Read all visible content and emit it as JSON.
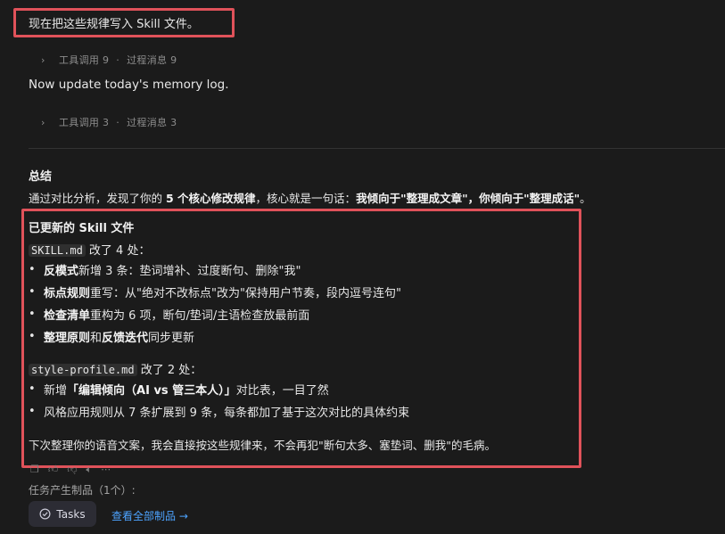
{
  "user_message": "现在把这些规律写入 Skill 文件。",
  "tool_row_1": {
    "tool_calls": "工具调用 9",
    "process_messages": "过程消息 9"
  },
  "assistant_line": "Now update today's memory log.",
  "tool_row_2": {
    "tool_calls": "工具调用 3",
    "process_messages": "过程消息 3"
  },
  "separator_dot": "·",
  "summary": {
    "heading": "总结",
    "intro_a": "通过对比分析，发现了你的 ",
    "intro_b": "5 个核心修改规律",
    "intro_c": "，核心就是一句话：",
    "intro_d": "我倾向于\"整理成文章\"，你倾向于\"整理成话\"",
    "intro_e": "。"
  },
  "updated": {
    "heading": "已更新的 Skill 文件",
    "skill_file": "SKILL.md",
    "skill_changes": " 改了 4 处：",
    "skill_items": [
      {
        "bold": "反模式",
        "text": " 新增 3 条：垫词增补、过度断句、删除\"我\""
      },
      {
        "bold": "标点规则",
        "text": " 重写：从\"绝对不改标点\"改为\"保持用户节奏，段内逗号连句\""
      },
      {
        "bold": "检查清单",
        "text": " 重构为 6 项，断句/垫词/主语检查放最前面"
      },
      {
        "bold": "整理原则",
        "mid": " 和 ",
        "bold2": "反馈迭代",
        "text": " 同步更新"
      }
    ],
    "style_file": "style-profile.md",
    "style_changes": " 改了 2 处：",
    "style_items": [
      {
        "pre": "新增 ",
        "bold": "「编辑倾向（AI vs 管三本人）」",
        "text": " 对比表，一目了然"
      },
      {
        "pre": "风格应用规则从 7 条扩展到 9 条，每条都加了基于这次对比的具体约束"
      }
    ],
    "closing": "下次整理你的语音文案，我会直接按这些规律来，不会再犯\"断句太多、塞垫词、删我\"的毛病。"
  },
  "artifacts_label": "任务产生制品（1个）:",
  "tasks_button": "Tasks",
  "view_all_link": "查看全部制品 →",
  "icons": [
    "copy-icon",
    "thumbs-up-icon",
    "thumbs-down-icon",
    "speaker-icon",
    "more-icon"
  ],
  "accent_link": "#4da3ff",
  "highlight_color": "#e0525a"
}
